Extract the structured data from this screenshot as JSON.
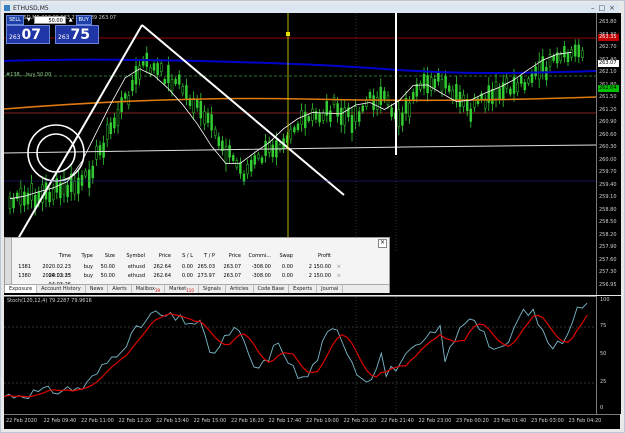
{
  "window": {
    "title": "ETHUSD,M5"
  },
  "one_click": {
    "sell_label": "SELL",
    "buy_label": "BUY",
    "volume": "50.00",
    "bid_small": "263",
    "bid_big": "07",
    "ask_small": "263",
    "ask_big": "75"
  },
  "chart": {
    "info_line": "ETHUSD,M5 263.20 263.27 262.89 263.07",
    "position_label": "#138... buy 50.00",
    "price_levels": [
      "263.80",
      "263.30",
      "262.70",
      "262.40",
      "262.10",
      "261.80",
      "261.50",
      "261.20",
      "260.90",
      "260.60",
      "260.30",
      "260.00",
      "259.70",
      "259.40",
      "259.10",
      "258.80",
      "258.50",
      "258.20",
      "257.90",
      "257.60",
      "257.30",
      "256.95"
    ],
    "price_tags": [
      {
        "label": "263.35",
        "bg": "#c00000",
        "color": "#ffffff"
      },
      {
        "label": "263.07",
        "bg": "#ffffff",
        "color": "#000000"
      },
      {
        "label": "262.64",
        "bg": "#00c000",
        "color": "#000000"
      }
    ]
  },
  "stochastic": {
    "label": "Stoch(120,12,4) 79.2287 79.9616",
    "levels": [
      "100",
      "75",
      "50",
      "25",
      "0"
    ]
  },
  "time_axis": [
    "22 Feb 2020",
    "22 Feb 09:40",
    "22 Feb 11:00",
    "22 Feb 12:20",
    "22 Feb 13:40",
    "22 Feb 15:00",
    "22 Feb 16:20",
    "22 Feb 17:40",
    "22 Feb 19:00",
    "22 Feb 20:20",
    "22 Feb 21:40",
    "22 Feb 23:00",
    "23 Feb 00:20",
    "23 Feb 01:40",
    "23 Feb 03:00",
    "23 Feb 04:20"
  ],
  "terminal": {
    "columns": [
      "Time",
      "Type",
      "Size",
      "Symbol",
      "Price",
      "S / L",
      "T / P",
      "Price",
      "Commi...",
      "Swap",
      "Profit"
    ],
    "rows": [
      {
        "order": "1381",
        "time": "2020.02.23 04:03:35",
        "type": "buy",
        "size": "50.00",
        "symbol": "ethusd",
        "price": "262.64",
        "sl": "0.00",
        "tp": "265.03",
        "cur_price": "263.07",
        "commission": "-308.00",
        "swap": "0.00",
        "profit": "2 150.00"
      },
      {
        "order": "1380",
        "time": "2020.02.23 04:03:26",
        "type": "buy",
        "size": "50.00",
        "symbol": "ethusd",
        "price": "262.64",
        "sl": "0.00",
        "tp": "273.97",
        "cur_price": "263.07",
        "commission": "-308.00",
        "swap": "0.00",
        "profit": "2 150.00"
      }
    ],
    "tabs": [
      {
        "label": "Exposure"
      },
      {
        "label": "Account History"
      },
      {
        "label": "News"
      },
      {
        "label": "Alerts"
      },
      {
        "label": "Mailbox",
        "badge": "39"
      },
      {
        "label": "Market",
        "badge": "110"
      },
      {
        "label": "Signals"
      },
      {
        "label": "Articles"
      },
      {
        "label": "Code Base"
      },
      {
        "label": "Experts"
      },
      {
        "label": "Journal"
      }
    ]
  },
  "colors": {
    "candle": "#33cc33",
    "ma_blue": "#0000cc",
    "ma_orange": "#e07a10",
    "stoch_main": "#7ab8c8",
    "stoch_signal": "#e00000",
    "sl_line": "#c00000",
    "drawing": "#ffffff",
    "crosshair": "#e8e000"
  }
}
